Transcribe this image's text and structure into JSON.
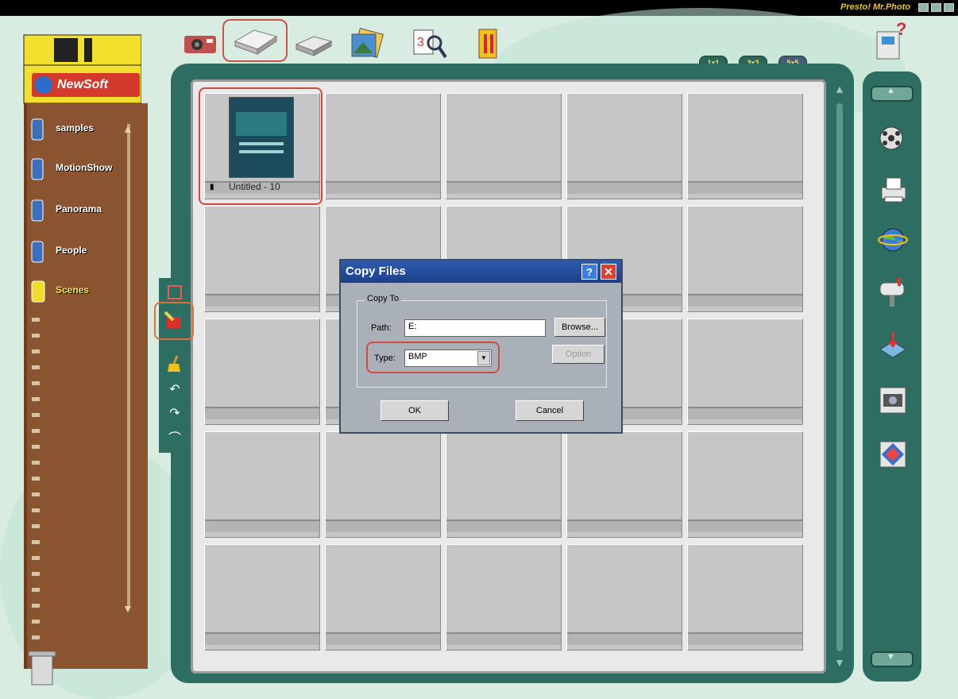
{
  "app": {
    "title": "Presto! Mr.Photo"
  },
  "brand": {
    "logo_text": "NewSoft"
  },
  "albums": [
    {
      "label": "samples"
    },
    {
      "label": "MotionShow"
    },
    {
      "label": "Panorama"
    },
    {
      "label": "People"
    },
    {
      "label": "Scenes"
    }
  ],
  "view_modes": [
    "1x1",
    "3x3",
    "5x5"
  ],
  "grid": {
    "thumb_caption": "Untitled - 10"
  },
  "dialog": {
    "title": "Copy Files",
    "help_glyph": "?",
    "close_glyph": "✕",
    "group_label": "Copy To",
    "path_label": "Path:",
    "path_value": "E:",
    "browse_label": "Browse...",
    "type_label": "Type:",
    "type_value": "BMP",
    "option_label": "Option",
    "ok_label": "OK",
    "cancel_label": "Cancel"
  },
  "colors": {
    "accent_red": "#d04a40",
    "panel_green": "#2e6e62",
    "film_brown": "#8a5430",
    "title_blue": "#2c5cae"
  }
}
